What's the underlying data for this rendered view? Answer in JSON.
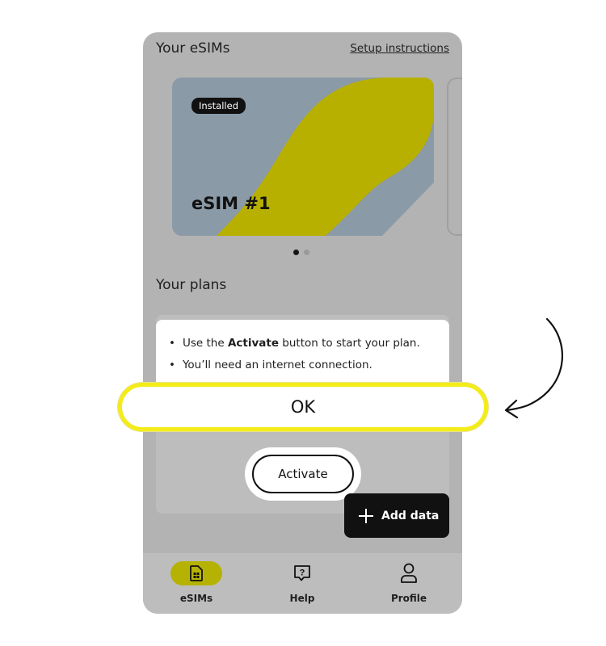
{
  "header": {
    "title": "Your eSIMs",
    "setup_link": "Setup instructions"
  },
  "esim_card": {
    "badge": "Installed",
    "name": "eSIM #1"
  },
  "carousel": {
    "count": 2,
    "active_index": 0
  },
  "plans": {
    "title": "Your plans",
    "tips": [
      {
        "prefix": "Use the ",
        "bold": "Activate",
        "suffix": " button to start your plan."
      },
      {
        "prefix": "You’ll need an internet connection.",
        "bold": "",
        "suffix": ""
      }
    ],
    "activate_label": "Activate"
  },
  "add_data_label": "Add data",
  "ok_label": "OK",
  "nav": [
    {
      "label": "eSIMs",
      "icon": "sim-card-icon",
      "active": true
    },
    {
      "label": "Help",
      "icon": "help-chat-icon",
      "active": false
    },
    {
      "label": "Profile",
      "icon": "profile-icon",
      "active": false
    }
  ],
  "colors": {
    "accent": "#b6b204",
    "highlight": "#f3ec1a",
    "card_blue": "#8a9aa7",
    "card_yellow": "#b7b000"
  }
}
